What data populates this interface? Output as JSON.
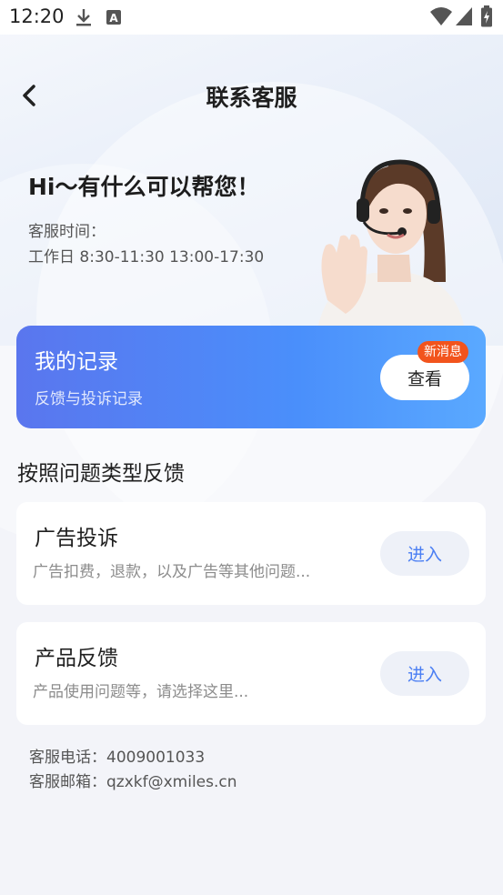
{
  "status_bar": {
    "time": "12:20",
    "icons": [
      "download-icon",
      "a-icon",
      "wifi-icon",
      "signal-icon",
      "battery-icon"
    ]
  },
  "header": {
    "title": "联系客服",
    "back_icon": "chevron-left-icon"
  },
  "hero": {
    "greeting": "Hi～有什么可以帮您！",
    "service_label": "客服时间：",
    "service_hours": "工作日 8:30-11:30 13:00-17:30"
  },
  "record": {
    "title": "我的记录",
    "subtitle": "反馈与投诉记录",
    "button": "查看",
    "badge": "新消息"
  },
  "section_title": "按照问题类型反馈",
  "types": [
    {
      "title": "广告投诉",
      "desc": "广告扣费，退款，以及广告等其他问题...",
      "button": "进入"
    },
    {
      "title": "产品反馈",
      "desc": "产品使用问题等，请选择这里...",
      "button": "进入"
    }
  ],
  "contact": {
    "phone": "客服电话：4009001033",
    "email": "客服邮箱：qzxkf@xmiles.cn"
  },
  "colors": {
    "accent": "#4a7ef3",
    "badge": "#f2541d",
    "card_gradient_start": "#5a76ee",
    "card_gradient_end": "#5aa9ff"
  }
}
